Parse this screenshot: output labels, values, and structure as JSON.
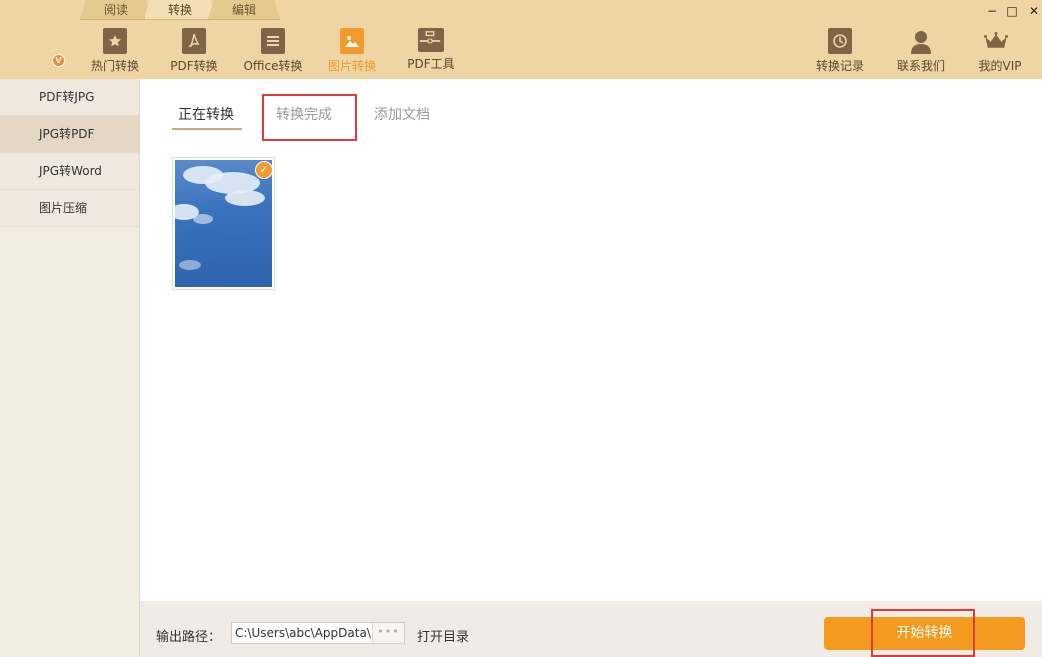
{
  "mode_tabs": [
    "阅读",
    "转换",
    "编辑"
  ],
  "active_mode": "转换",
  "toolbar": {
    "hot": "热门转换",
    "pdf": "PDF转换",
    "office": "Office转换",
    "image": "图片转换",
    "pdftools": "PDF工具",
    "history": "转换记录",
    "contact": "联系我们",
    "vip": "我的VIP"
  },
  "vip_badge": "V",
  "window_controls": {
    "minimize": "−",
    "maximize": "□",
    "close": "✕"
  },
  "sidebar": {
    "items": [
      "PDF转JPG",
      "JPG转PDF",
      "JPG转Word",
      "图片压缩"
    ],
    "active_index": 1
  },
  "main": {
    "tabs": [
      "正在转换",
      "转换完成",
      "添加文档"
    ],
    "active_tab": "正在转换",
    "selected_item_check": "✓"
  },
  "footer": {
    "output_label": "输出路径：",
    "output_path": "C:\\Users\\abc\\AppData\\",
    "browse": "•••",
    "open_dir": "打开目录",
    "start": "开始转换"
  },
  "colors": {
    "header_bg": "#efd5a3",
    "accent": "#f19a2e",
    "start_button": "#f39a1f",
    "highlight_box": "#e03b3b"
  }
}
